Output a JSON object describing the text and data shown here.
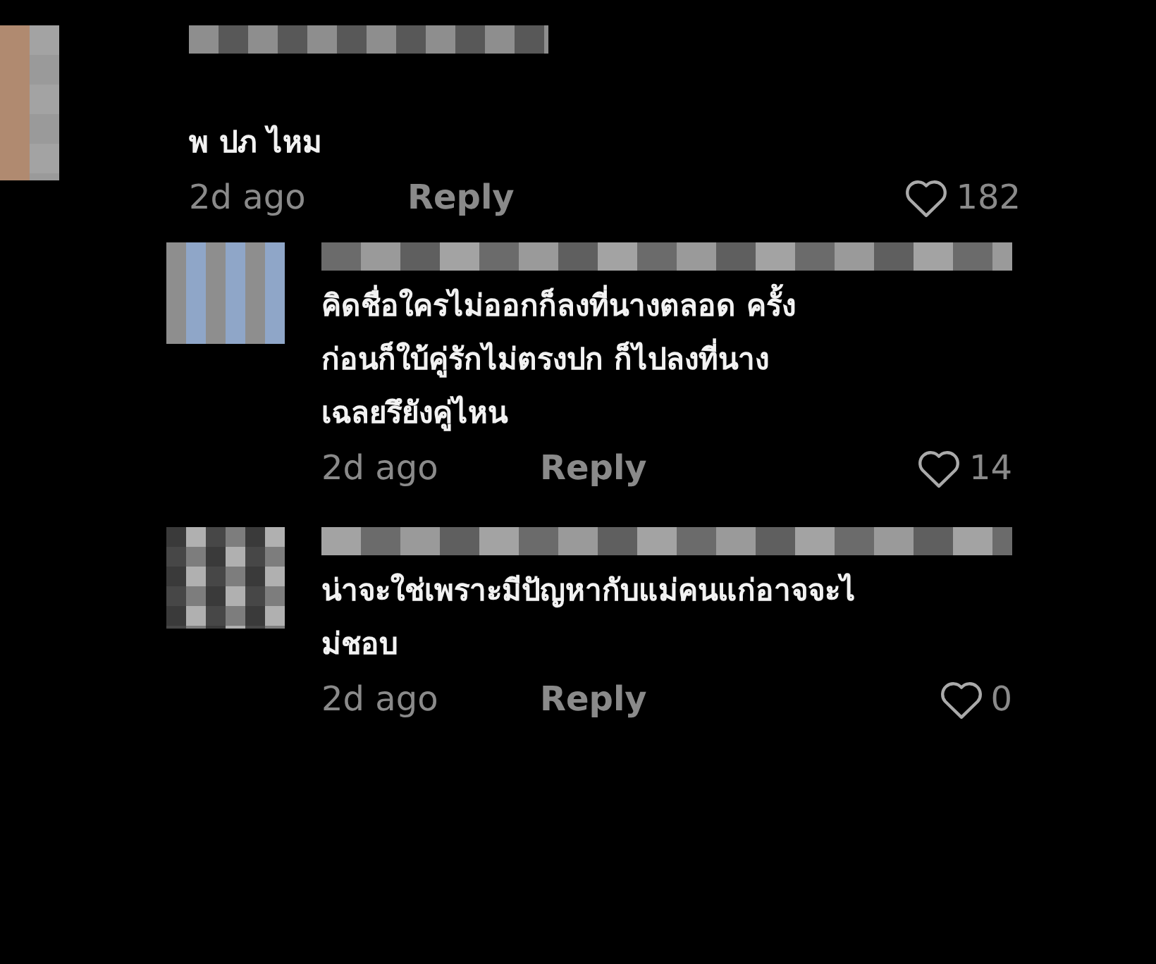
{
  "comments": [
    {
      "lines": [
        "พ ปภ ไหม"
      ],
      "time": "2d ago",
      "reply": "Reply",
      "likes": "182",
      "children": [
        {
          "lines": [
            "คิดชื่อใครไม่ออกก็ลงที่นางตลอด  ครั้ง",
            "ก่อนก็ใบ้คู่รักไม่ตรงปก  ก็ไปลงที่นาง",
            "เฉลยรึยังคู่ไหน"
          ],
          "time": "2d ago",
          "reply": "Reply",
          "likes": "14"
        },
        {
          "lines": [
            "น่าจะใช่เพราะมีปัญหากับแม่คนแก่อาจจะไ",
            "ม่ชอบ"
          ],
          "time": "2d ago",
          "reply": "Reply",
          "likes": "0"
        }
      ]
    }
  ]
}
